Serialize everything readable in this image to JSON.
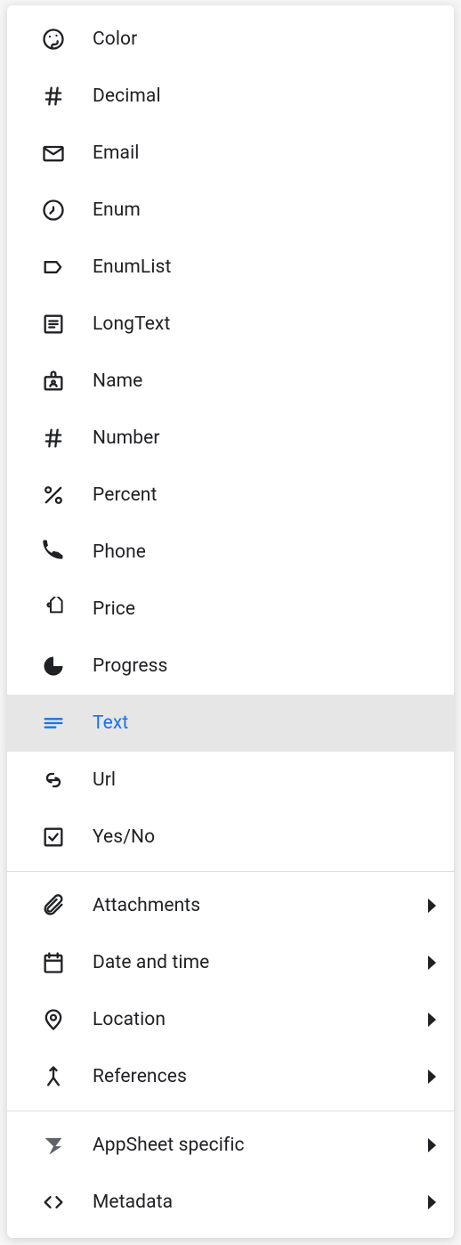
{
  "menu": {
    "section1": [
      {
        "icon": "palette-icon",
        "label": "Color"
      },
      {
        "icon": "hash-icon",
        "label": "Decimal"
      },
      {
        "icon": "email-icon",
        "label": "Email"
      },
      {
        "icon": "clock-icon",
        "label": "Enum"
      },
      {
        "icon": "label-icon",
        "label": "EnumList"
      },
      {
        "icon": "document-icon",
        "label": "LongText"
      },
      {
        "icon": "badge-icon",
        "label": "Name"
      },
      {
        "icon": "hash-icon",
        "label": "Number"
      },
      {
        "icon": "percent-icon",
        "label": "Percent"
      },
      {
        "icon": "phone-icon",
        "label": "Phone"
      },
      {
        "icon": "tag-icon",
        "label": "Price"
      },
      {
        "icon": "pie-icon",
        "label": "Progress"
      },
      {
        "icon": "text-icon",
        "label": "Text",
        "selected": true
      },
      {
        "icon": "link-icon",
        "label": "Url"
      },
      {
        "icon": "checkbox-icon",
        "label": "Yes/No"
      }
    ],
    "section2": [
      {
        "icon": "attachment-icon",
        "label": "Attachments",
        "submenu": true
      },
      {
        "icon": "calendar-icon",
        "label": "Date and time",
        "submenu": true
      },
      {
        "icon": "location-icon",
        "label": "Location",
        "submenu": true
      },
      {
        "icon": "merge-icon",
        "label": "References",
        "submenu": true
      }
    ],
    "section3": [
      {
        "icon": "appsheet-icon",
        "label": "AppSheet specific",
        "submenu": true
      },
      {
        "icon": "code-icon",
        "label": "Metadata",
        "submenu": true
      }
    ]
  }
}
